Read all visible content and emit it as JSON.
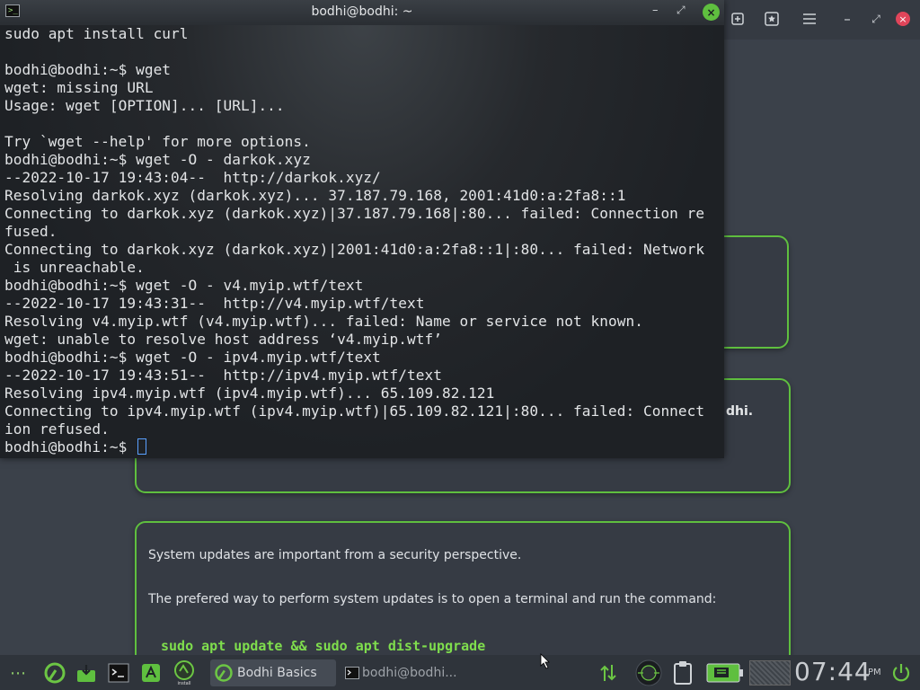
{
  "terminal": {
    "title": "bodhi@bodhi: ~",
    "icon": "terminal-icon",
    "controls": {
      "minimize": "–",
      "restore": "⤢",
      "close": "×"
    },
    "lines": [
      "sudo apt install curl",
      "",
      "bodhi@bodhi:~$ wget",
      "wget: missing URL",
      "Usage: wget [OPTION]... [URL]...",
      "",
      "Try `wget --help' for more options.",
      "bodhi@bodhi:~$ wget -O - darkok.xyz",
      "--2022-10-17 19:43:04--  http://darkok.xyz/",
      "Resolving darkok.xyz (darkok.xyz)... 37.187.79.168, 2001:41d0:a:2fa8::1",
      "Connecting to darkok.xyz (darkok.xyz)|37.187.79.168|:80... failed: Connection re",
      "fused.",
      "Connecting to darkok.xyz (darkok.xyz)|2001:41d0:a:2fa8::1|:80... failed: Network",
      " is unreachable.",
      "bodhi@bodhi:~$ wget -O - v4.myip.wtf/text",
      "--2022-10-17 19:43:31--  http://v4.myip.wtf/text",
      "Resolving v4.myip.wtf (v4.myip.wtf)... failed: Name or service not known.",
      "wget: unable to resolve host address ‘v4.myip.wtf’",
      "bodhi@bodhi:~$ wget -O - ipv4.myip.wtf/text",
      "--2022-10-17 19:43:51--  http://ipv4.myip.wtf/text",
      "Resolving ipv4.myip.wtf (ipv4.myip.wtf)... 65.109.82.121",
      "Connecting to ipv4.myip.wtf (ipv4.myip.wtf)|65.109.82.121|:80... failed: Connect",
      "ion refused."
    ],
    "prompt": "bodhi@bodhi:~$ "
  },
  "background_window": {
    "toolbar_icons": [
      "new-tab-icon",
      "bookmark-icon",
      "menu-icon"
    ],
    "controls": {
      "minimize": "–",
      "restore": "⤢",
      "close": "×"
    },
    "peek_text": "dhi.",
    "card_text_1": "System updates are important from a security perspective.",
    "card_text_2": "The prefered way to perform system updates is to open a terminal and run the command:",
    "card_command": "sudo apt update && sudo apt dist-upgrade"
  },
  "taskbar": {
    "tasks": [
      {
        "label": "Bodhi Basics",
        "icon": "bodhi-leaf-icon"
      },
      {
        "label": "bodhi@bodhi...",
        "icon": "terminal-icon"
      }
    ],
    "clock": {
      "time": "07:44",
      "ampm": "PM"
    }
  },
  "colors": {
    "accent": "#5fbf3f",
    "close": "#e0455a",
    "cursor": "#5aa0ff"
  }
}
